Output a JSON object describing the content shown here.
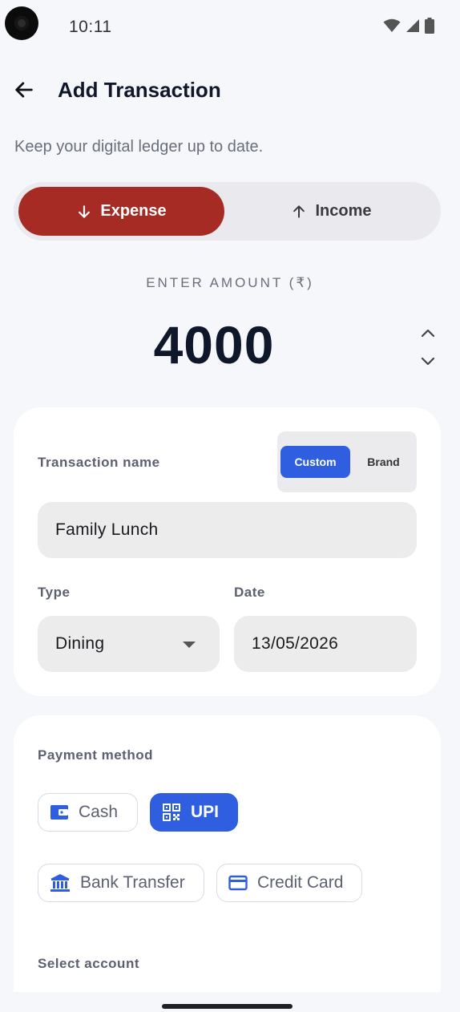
{
  "status_bar": {
    "time": "10:11"
  },
  "header": {
    "title": "Add Transaction"
  },
  "subtitle": "Keep your digital ledger up to date.",
  "transaction_type": {
    "expense_label": "Expense",
    "income_label": "Income",
    "selected": "Expense",
    "expense_color": "#a62b25"
  },
  "amount": {
    "label": "ENTER AMOUNT (₹)",
    "value": "4000"
  },
  "details": {
    "name_label": "Transaction name",
    "name_mode": {
      "custom_label": "Custom",
      "brand_label": "Brand",
      "selected": "Custom"
    },
    "name_value": "Family Lunch",
    "type_label": "Type",
    "type_value": "Dining",
    "date_label": "Date",
    "date_value": "13/05/2026"
  },
  "payment": {
    "label": "Payment method",
    "methods": [
      {
        "label": "Cash",
        "icon": "wallet-icon",
        "selected": false
      },
      {
        "label": "UPI",
        "icon": "qr-code-icon",
        "selected": true
      },
      {
        "label": "Bank Transfer",
        "icon": "bank-icon",
        "selected": false
      },
      {
        "label": "Credit Card",
        "icon": "credit-card-icon",
        "selected": false
      }
    ],
    "accent_color": "#2f5fe0"
  },
  "account": {
    "label": "Select account"
  }
}
